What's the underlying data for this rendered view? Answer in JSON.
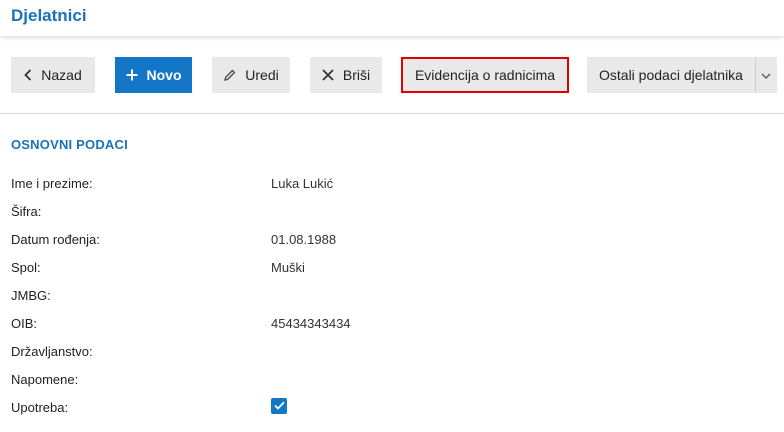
{
  "header": {
    "title": "Djelatnici"
  },
  "toolbar": {
    "back_label": "Nazad",
    "new_label": "Novo",
    "edit_label": "Uredi",
    "delete_label": "Briši",
    "records_label": "Evidencija o radnicima",
    "other_label": "Ostali podaci djelatnika"
  },
  "section": {
    "title": "OSNOVNI PODACI"
  },
  "fields": [
    {
      "label": "Ime i prezime:",
      "value": "Luka Lukić"
    },
    {
      "label": "Šifra:",
      "value": ""
    },
    {
      "label": "Datum rođenja:",
      "value": "01.08.1988"
    },
    {
      "label": "Spol:",
      "value": "Muški"
    },
    {
      "label": "JMBG:",
      "value": ""
    },
    {
      "label": "OIB:",
      "value": "45434343434"
    },
    {
      "label": "Državljanstvo:",
      "value": ""
    },
    {
      "label": "Napomene:",
      "value": ""
    },
    {
      "label": "Upotreba:",
      "checked": true
    }
  ],
  "colors": {
    "accent": "#1a73ba",
    "primary_button": "#1476c6",
    "highlight": "#e00000",
    "button_bg": "#e9e9e9"
  },
  "icons": [
    "chevron-left-icon",
    "plus-icon",
    "pencil-icon",
    "x-icon",
    "chevron-down-icon",
    "check-icon"
  ]
}
